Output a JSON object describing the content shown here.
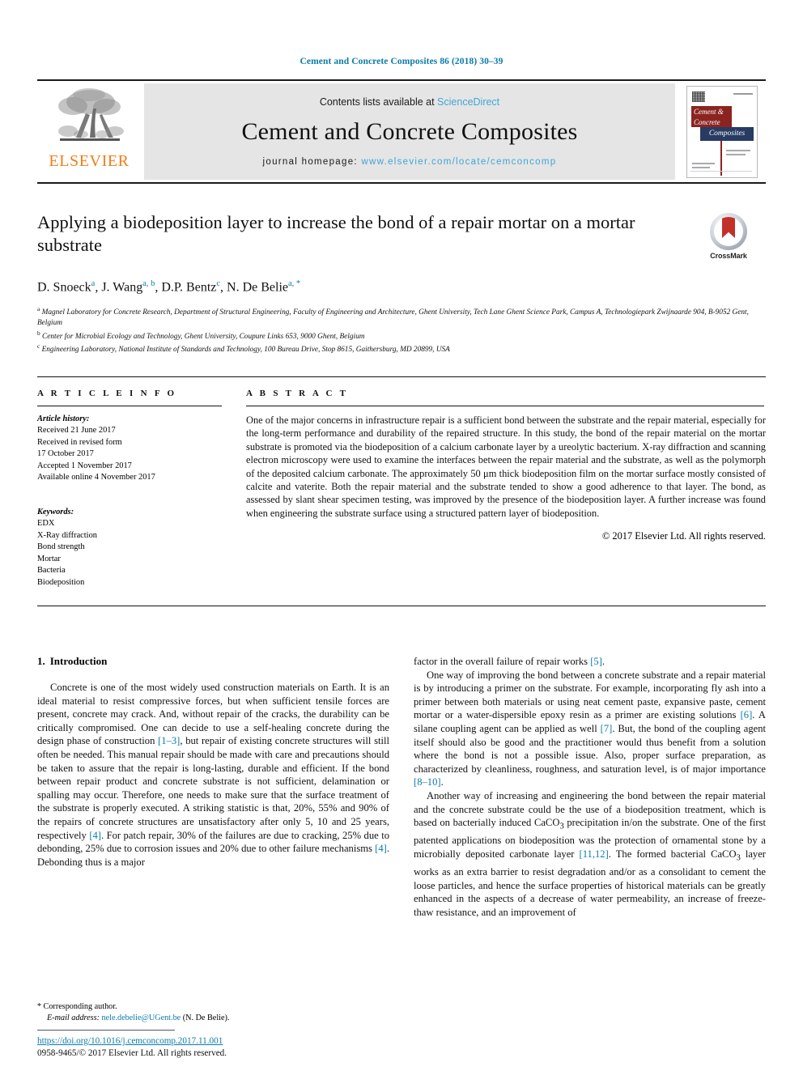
{
  "running_head": "Cement and Concrete Composites 86 (2018) 30–39",
  "masthead": {
    "publisher_logo_text": "ELSEVIER",
    "contents_prefix": "Contents lists available at ",
    "contents_link": "ScienceDirect",
    "journal_name": "Cement and Concrete Composites",
    "homepage_prefix": "journal homepage: ",
    "homepage_url": "www.elsevier.com/locate/cemconcomp",
    "cover": {
      "line1": "Cement &",
      "line2": "Concrete",
      "line3": "Composites"
    }
  },
  "article": {
    "title": "Applying a biodeposition layer to increase the bond of a repair mortar on a mortar substrate",
    "crossmark_label": "CrossMark",
    "authors": [
      {
        "name": "D. Snoeck",
        "marks": "a"
      },
      {
        "name": "J. Wang",
        "marks": "a, b"
      },
      {
        "name": "D.P. Bentz",
        "marks": "c"
      },
      {
        "name": "N. De Belie",
        "marks": "a, *"
      }
    ],
    "affiliations": [
      {
        "mark": "a",
        "text": "Magnel Laboratory for Concrete Research, Department of Structural Engineering, Faculty of Engineering and Architecture, Ghent University, Tech Lane Ghent Science Park, Campus A, Technologiepark Zwijnaarde 904, B-9052 Gent, Belgium"
      },
      {
        "mark": "b",
        "text": "Center for Microbial Ecology and Technology, Ghent University, Coupure Links 653, 9000 Ghent, Belgium"
      },
      {
        "mark": "c",
        "text": "Engineering Laboratory, National Institute of Standards and Technology, 100 Bureau Drive, Stop 8615, Gaithersburg, MD 20899, USA"
      }
    ]
  },
  "article_info": {
    "heading": "A R T I C L E   I N F O",
    "history_label": "Article history:",
    "history": [
      "Received 21 June 2017",
      "Received in revised form",
      "17 October 2017",
      "Accepted 1 November 2017",
      "Available online 4 November 2017"
    ],
    "keywords_label": "Keywords:",
    "keywords": [
      "EDX",
      "X-Ray diffraction",
      "Bond strength",
      "Mortar",
      "Bacteria",
      "Biodeposition"
    ]
  },
  "abstract": {
    "heading": "A B S T R A C T",
    "text": "One of the major concerns in infrastructure repair is a sufficient bond between the substrate and the repair material, especially for the long-term performance and durability of the repaired structure. In this study, the bond of the repair material on the mortar substrate is promoted via the biodeposition of a calcium carbonate layer by a ureolytic bacterium. X-ray diffraction and scanning electron microscopy were used to examine the interfaces between the repair material and the substrate, as well as the polymorph of the deposited calcium carbonate. The approximately 50 μm thick biodeposition film on the mortar surface mostly consisted of calcite and vaterite. Both the repair material and the substrate tended to show a good adherence to that layer. The bond, as assessed by slant shear specimen testing, was improved by the presence of the biodeposition layer. A further increase was found when engineering the substrate surface using a structured pattern layer of biodeposition.",
    "copyright": "© 2017 Elsevier Ltd. All rights reserved."
  },
  "body": {
    "section_number": "1.",
    "section_title": "Introduction",
    "left_paragraphs": [
      "Concrete is one of the most widely used construction materials on Earth. It is an ideal material to resist compressive forces, but when sufficient tensile forces are present, concrete may crack. And, without repair of the cracks, the durability can be critically compromised. One can decide to use a self-healing concrete during the design phase of construction [1–3], but repair of existing concrete structures will still often be needed. This manual repair should be made with care and precautions should be taken to assure that the repair is long-lasting, durable and efficient. If the bond between repair product and concrete substrate is not sufficient, delamination or spalling may occur. Therefore, one needs to make sure that the surface treatment of the substrate is properly executed. A striking statistic is that, 20%, 55% and 90% of the repairs of concrete structures are unsatisfactory after only 5, 10 and 25 years, respectively [4]. For patch repair, 30% of the failures are due to cracking, 25% due to debonding, 25% due to corrosion issues and 20% due to other failure mechanisms [4]. Debonding thus is a major"
    ],
    "right_paragraphs": [
      "factor in the overall failure of repair works [5].",
      "One way of improving the bond between a concrete substrate and a repair material is by introducing a primer on the substrate. For example, incorporating fly ash into a primer between both materials or using neat cement paste, expansive paste, cement mortar or a water-dispersible epoxy resin as a primer are existing solutions [6]. A silane coupling agent can be applied as well [7]. But, the bond of the coupling agent itself should also be good and the practitioner would thus benefit from a solution where the bond is not a possible issue. Also, proper surface preparation, as characterized by cleanliness, roughness, and saturation level, is of major importance [8–10].",
      "Another way of increasing and engineering the bond between the repair material and the concrete substrate could be the use of a biodeposition treatment, which is based on bacterially induced CaCO3 precipitation in/on the substrate. One of the first patented applications on biodeposition was the protection of ornamental stone by a microbially deposited carbonate layer [11,12]. The formed bacterial CaCO3 layer works as an extra barrier to resist degradation and/or as a consolidant to cement the loose particles, and hence the surface properties of historical materials can be greatly enhanced in the aspects of a decrease of water permeability, an increase of freeze-thaw resistance, and an improvement of"
    ]
  },
  "footer": {
    "corresponding_marker": "*",
    "corresponding_label": "Corresponding author.",
    "email_label": "E-mail address:",
    "email": "nele.debelie@UGent.be",
    "email_owner": "(N. De Belie).",
    "doi": "https://doi.org/10.1016/j.cemconcomp.2017.11.001",
    "issn_line": "0958-9465/© 2017 Elsevier Ltd. All rights reserved."
  },
  "colors": {
    "link": "#0b7bab",
    "sciencedirect": "#3ea6d6",
    "elsevier_orange": "#f07d1a",
    "masthead_bg": "#e5e5e5"
  }
}
